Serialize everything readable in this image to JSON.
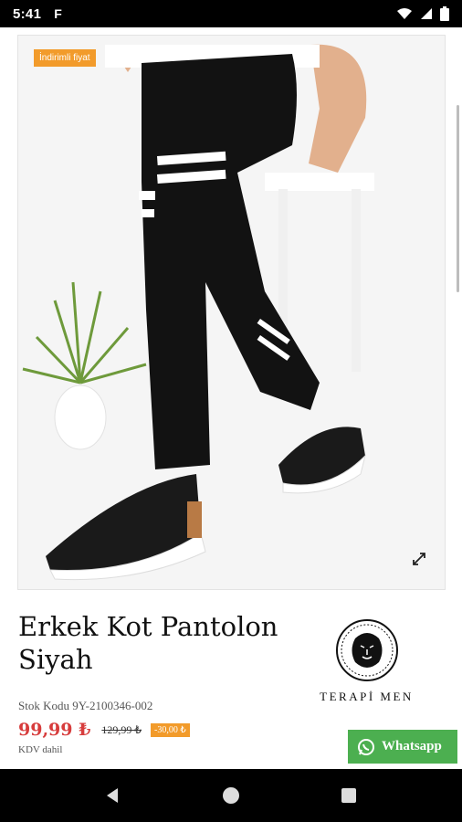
{
  "status_bar": {
    "time": "5:41",
    "app_indicator": "F",
    "icons": [
      "wifi-icon",
      "signal-icon",
      "battery-icon"
    ]
  },
  "product_image": {
    "discount_label": "İndirimli fiyat",
    "expand_icon": "expand-icon"
  },
  "product": {
    "title": "Erkek Kot Pantolon Siyah",
    "sku_text": "Stok Kodu 9Y-2100346-002",
    "price": "99,99 ₺",
    "old_price": "129,99 ₺",
    "discount_badge": "-30,00 ₺",
    "tax_note": "KDV dahil"
  },
  "brand": {
    "name": "TERAPİ MEN",
    "logo_icon": "lion-logo-icon"
  },
  "whatsapp": {
    "label": "Whatsapp",
    "color": "#4caf50"
  },
  "navigation": {
    "buttons": [
      "back-icon",
      "home-icon",
      "recents-icon"
    ]
  },
  "colors": {
    "price": "#d73c3c",
    "accent_orange": "#f29b2b"
  }
}
